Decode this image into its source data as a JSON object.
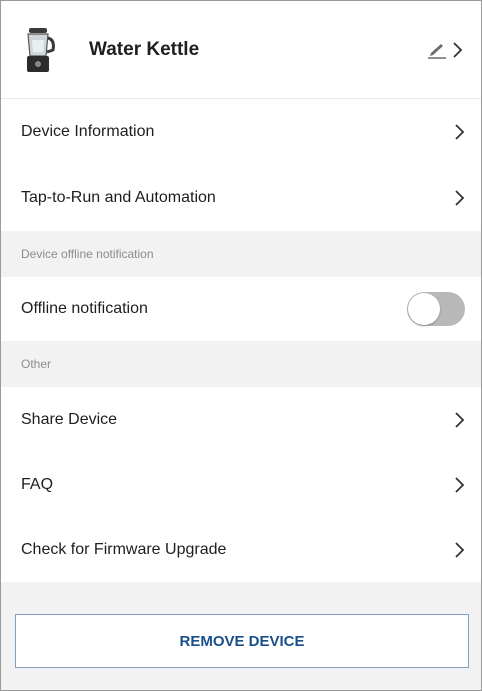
{
  "device": {
    "name": "Water Kettle",
    "icon": "blender-icon",
    "edit_icon": "pencil-edit-icon"
  },
  "menu": {
    "device_information": "Device Information",
    "tap_to_run": "Tap-to-Run and Automation"
  },
  "offline_section": {
    "header": "Device offline notification",
    "toggle_label": "Offline notification",
    "toggle_on": false
  },
  "other_section": {
    "header": "Other",
    "share_device": "Share Device",
    "faq": "FAQ",
    "firmware": "Check for Firmware Upgrade"
  },
  "remove_button": "REMOVE DEVICE",
  "colors": {
    "accent": "#1a4f8b",
    "toggle_off": "#b8b8b8",
    "section_bg": "#f2f2f2"
  }
}
